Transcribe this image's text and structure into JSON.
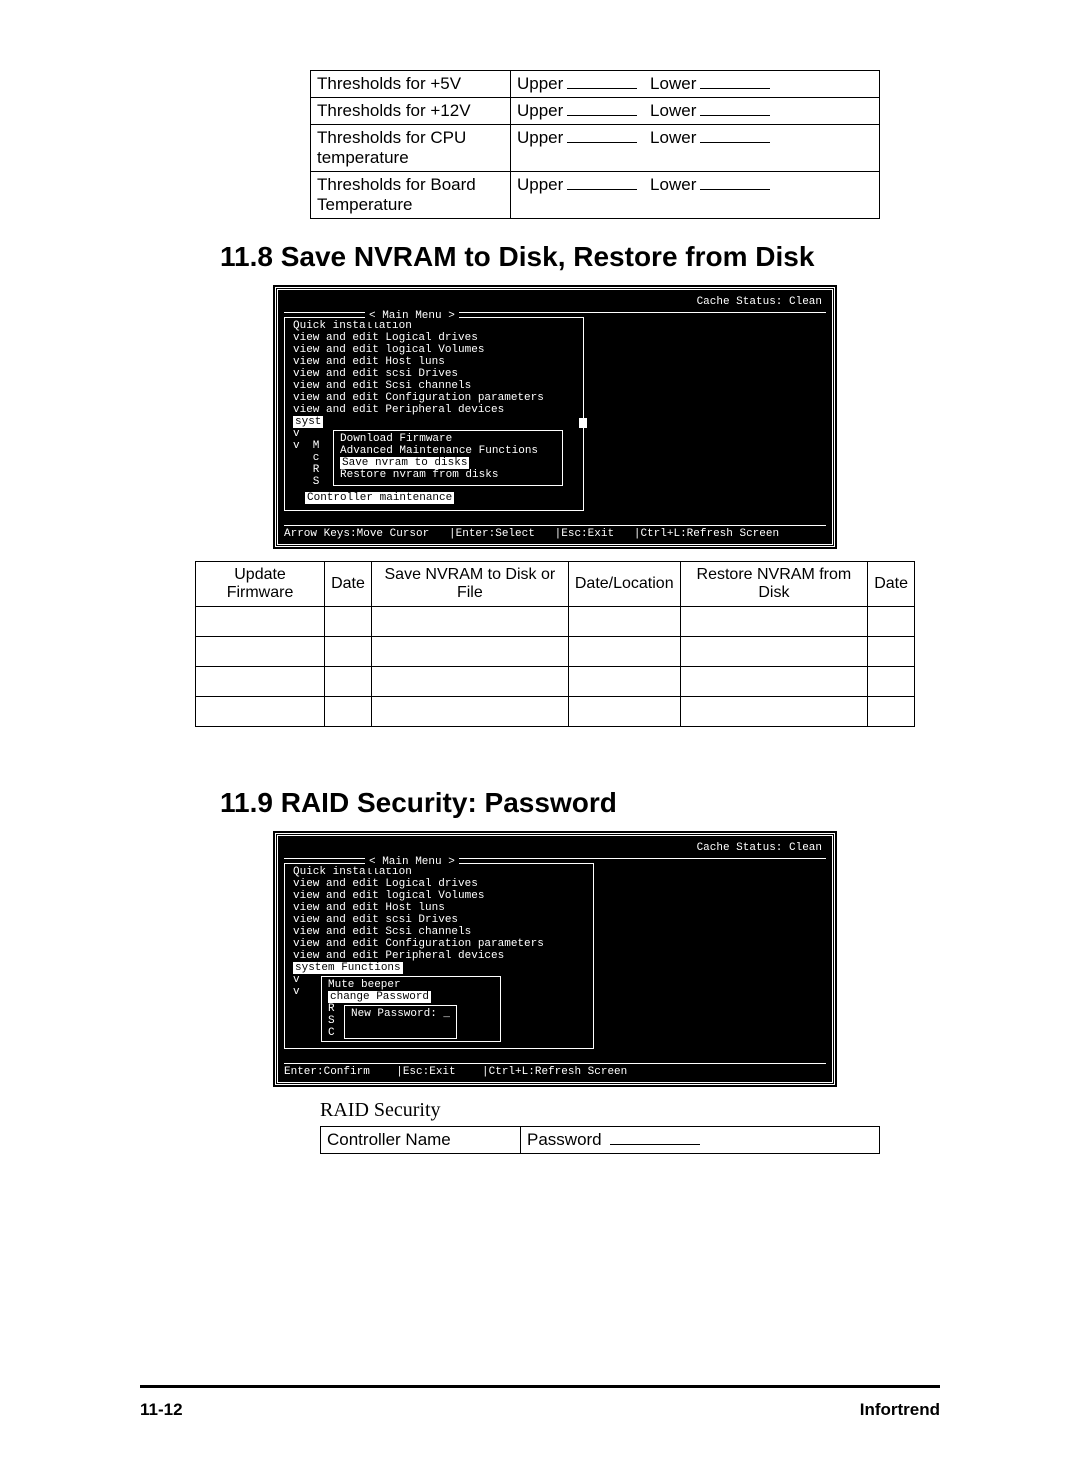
{
  "thresholds": {
    "rows": [
      {
        "label": "Thresholds for +5V",
        "upper": "Upper",
        "lower": "Lower"
      },
      {
        "label": "Thresholds for +12V",
        "upper": "Upper",
        "lower": "Lower"
      },
      {
        "label": "Thresholds for CPU temperature",
        "upper": "Upper",
        "lower": "Lower"
      },
      {
        "label": "Thresholds for Board Temperature",
        "upper": "Upper",
        "lower": "Lower"
      }
    ]
  },
  "section118": {
    "heading": "11.8 Save NVRAM to Disk, Restore from Disk"
  },
  "term1": {
    "status": "Cache Status: Clean",
    "menu_title": "< Main Menu >",
    "items": [
      "Quick installation",
      "view and edit Logical drives",
      "view and edit logical Volumes",
      "view and edit Host luns",
      "view and edit scsi Drives",
      "view and edit Scsi channels",
      "view and edit Configuration parameters",
      "view and edit Peripheral devices"
    ],
    "syst": "syst",
    "side": "v\nv  M\n   c\n   R\n   S",
    "submenu": [
      "Download Firmware",
      "Advanced Maintenance Functions",
      "Save nvram to disks",
      "Restore nvram from disks"
    ],
    "ctrl_maint": "Controller maintenance",
    "helpbar": "Arrow Keys:Move Cursor   |Enter:Select   |Esc:Exit   |Ctrl+L:Refresh Screen"
  },
  "log_table": {
    "headers": [
      "Update Firmware",
      "Date",
      "Save NVRAM to Disk or File",
      "Date/Location",
      "Restore NVRAM from Disk",
      "Date"
    ]
  },
  "section119": {
    "heading": "11.9 RAID Security: Password"
  },
  "term2": {
    "status": "Cache Status: Clean",
    "menu_title": "< Main Menu >",
    "items": [
      "Quick installation",
      "view and edit Logical drives",
      "view and edit logical Volumes",
      "view and edit Host luns",
      "view and edit scsi Drives",
      "view and edit Scsi channels",
      "view and edit Configuration parameters",
      "view and edit Peripheral devices"
    ],
    "sys_functions": "system Functions",
    "side": "v\nv",
    "submenu": [
      "Mute beeper",
      "change Password"
    ],
    "side2": "R\nS\nC",
    "new_pw": "New Password: _",
    "helpbar": "Enter:Confirm    |Esc:Exit    |Ctrl+L:Refresh Screen"
  },
  "raid_security": {
    "caption": "RAID Security",
    "col1": "Controller Name",
    "col2": "Password"
  },
  "footer": {
    "page": "11-12",
    "brand": "Infortrend"
  }
}
